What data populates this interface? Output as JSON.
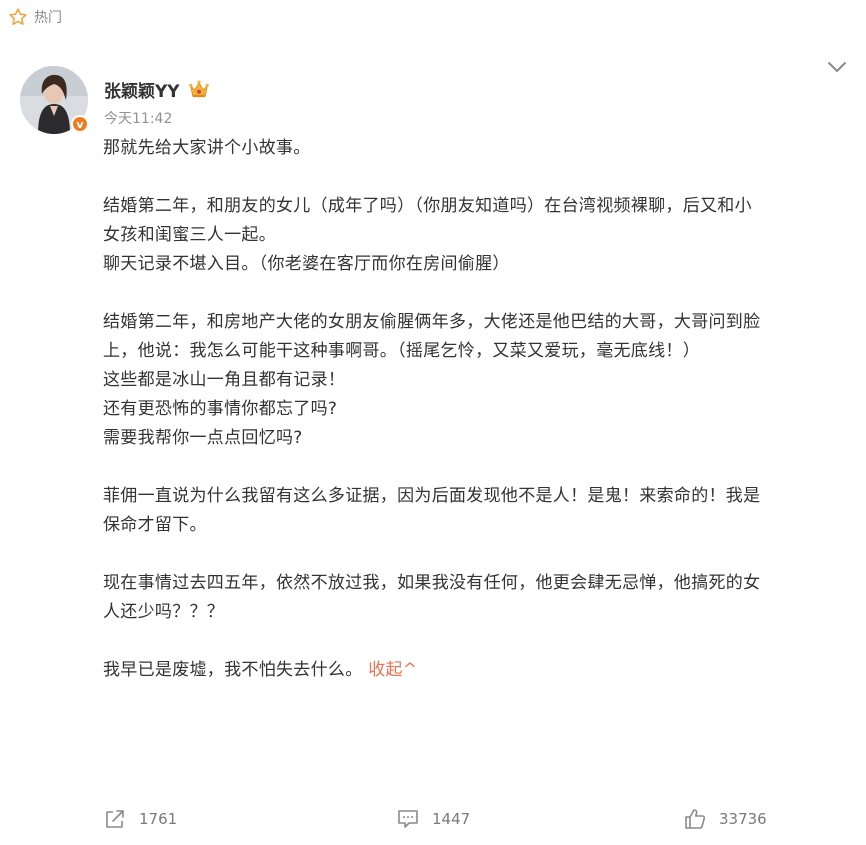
{
  "header": {
    "hot_label": "热门",
    "icon": "star-outline-icon"
  },
  "author": {
    "name": "张颖颖YY",
    "time": "今天11:42",
    "badge": "v",
    "crown_icon": "crown-icon",
    "verify_color": "#f07c1e"
  },
  "post": {
    "paragraphs": [
      [
        "那就先给大家讲个小故事。"
      ],
      [
        "结婚第二年，和朋友的女儿（成年了吗）（你朋友知道吗）在台湾视频裸聊，后又和小",
        "女孩和闺蜜三人一起。",
        "聊天记录不堪入目。（你老婆在客厅而你在房间偷腥）"
      ],
      [
        "结婚第二年，和房地产大佬的女朋友偷腥俩年多，大佬还是他巴结的大哥，大哥问到脸",
        "上，他说：我怎么可能干这种事啊哥。（摇尾乞怜，又菜又爱玩，毫无底线！）",
        "这些都是冰山一角且都有记录！",
        "还有更恐怖的事情你都忘了吗?",
        "需要我帮你一点点回忆吗?"
      ],
      [
        "菲佣一直说为什么我留有这么多证据，因为后面发现他不是人！是鬼！来索命的！我是",
        "保命才留下。"
      ],
      [
        "现在事情过去四五年，依然不放过我，如果我没有任何，他更会肆无忌惮，他搞死的女",
        "人还少吗？？？"
      ],
      [
        "我早已是废墟，我不怕失去什么。"
      ]
    ],
    "collapse_label": "收起^",
    "link_color": "#eb7350"
  },
  "actions": {
    "forward": {
      "count": "1761",
      "icon": "share-icon"
    },
    "comment": {
      "count": "1447",
      "icon": "comment-icon"
    },
    "like": {
      "count": "33736",
      "icon": "thumbs-up-icon"
    }
  }
}
